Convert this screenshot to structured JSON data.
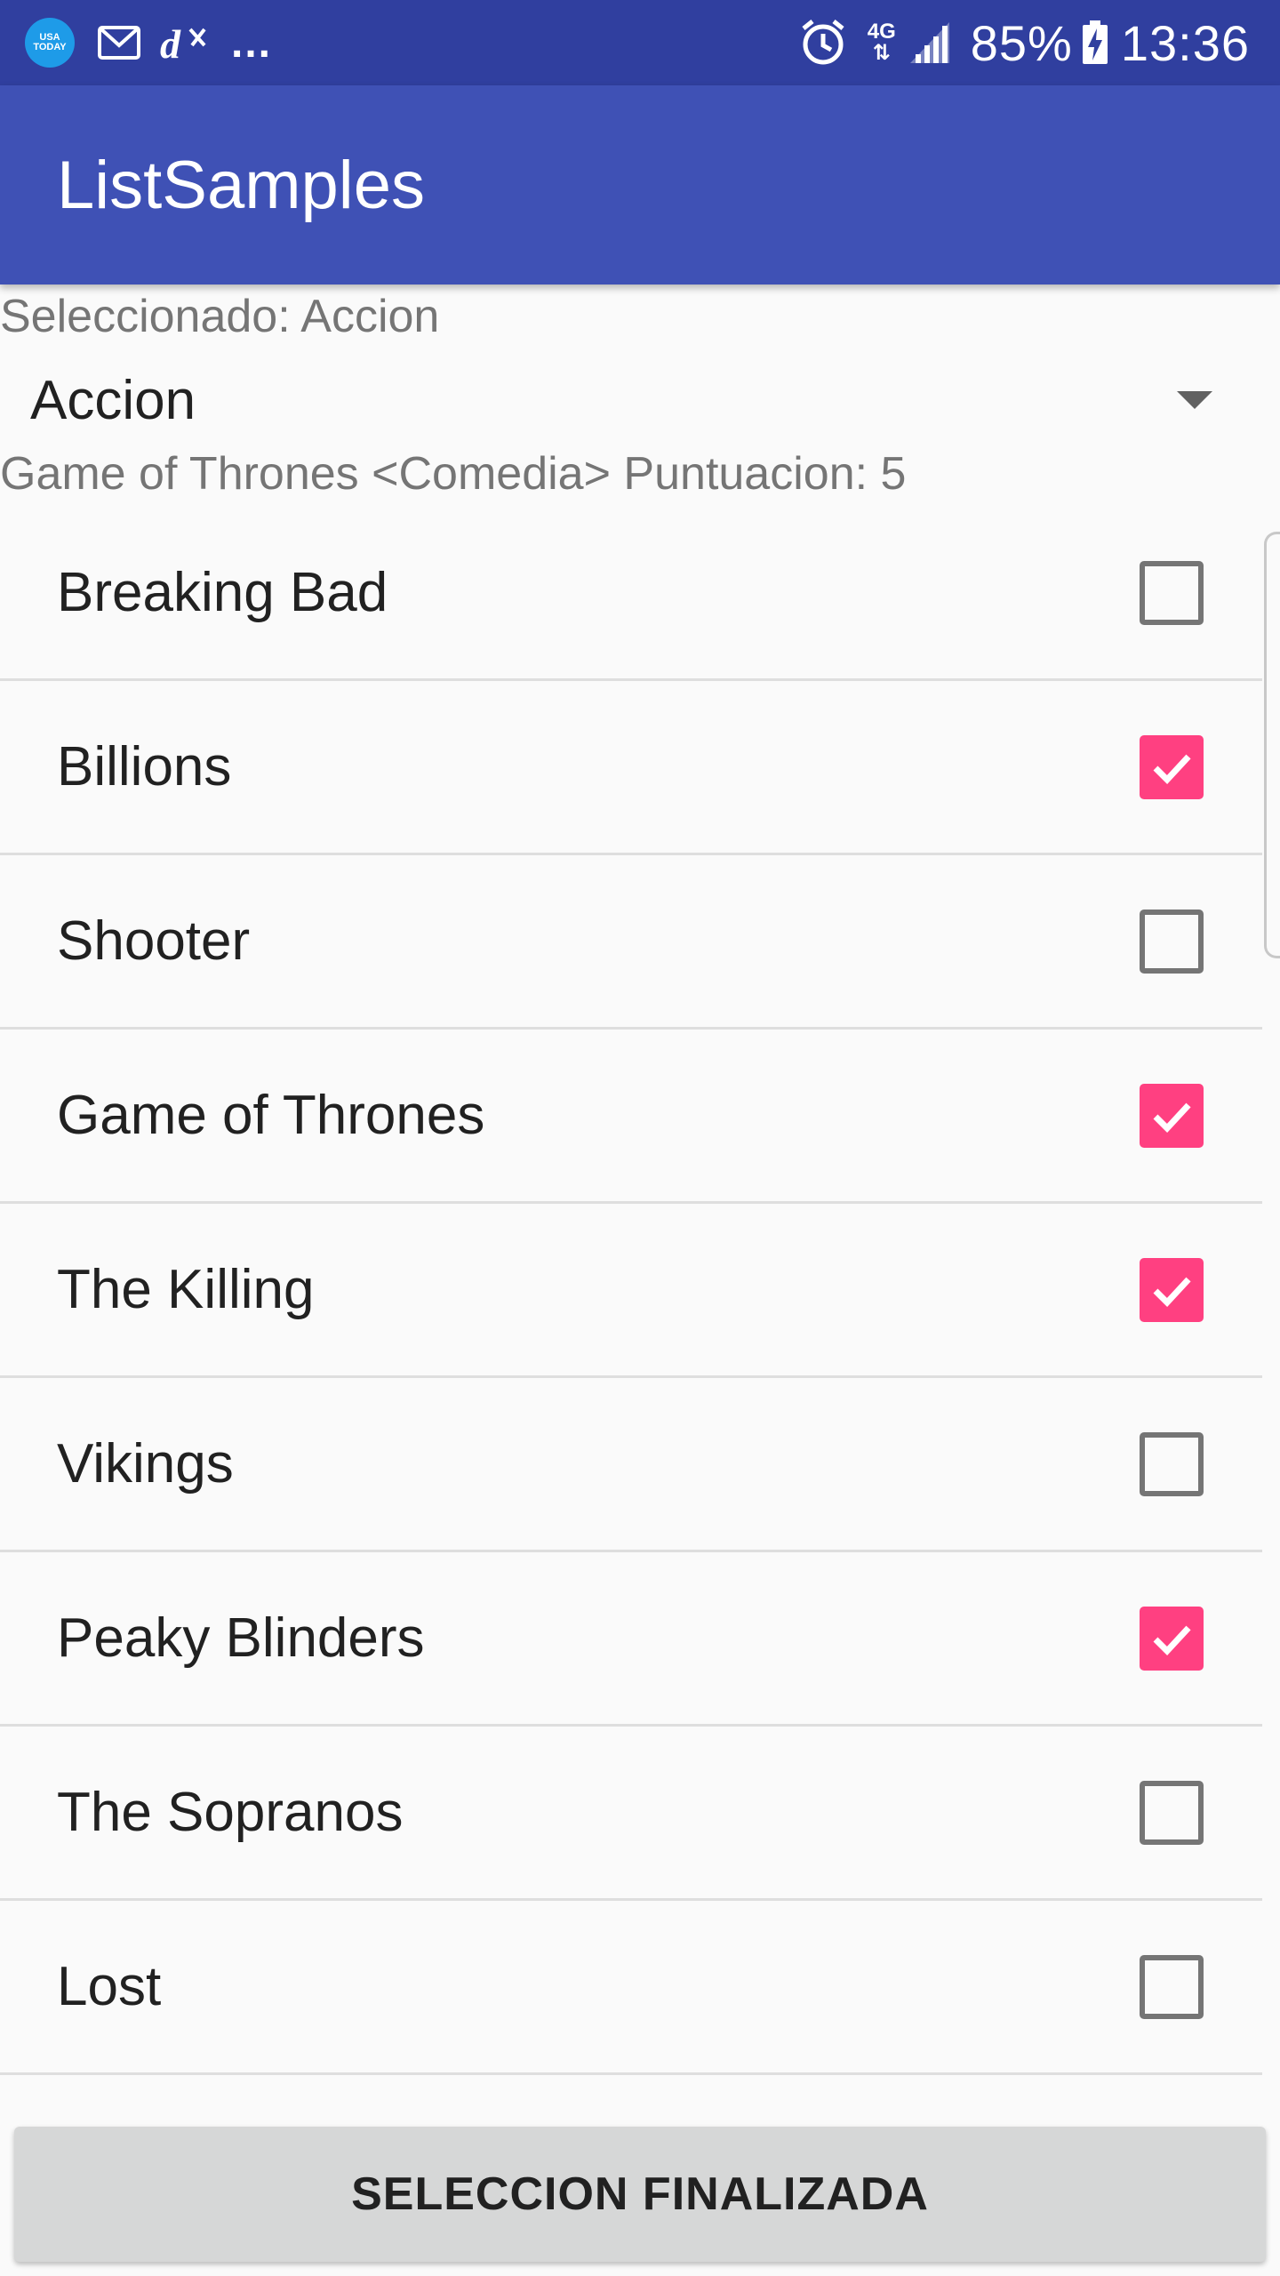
{
  "status_bar": {
    "notification_icons": [
      "usa-today-icon",
      "gmail-icon",
      "dazn-icon"
    ],
    "usa_today_line1": "USA",
    "usa_today_line2": "TODAY",
    "more": "...",
    "network_top": "4G",
    "battery": "85%",
    "time": "13:36"
  },
  "app_bar": {
    "title": "ListSamples"
  },
  "selected_label": "Seleccionado: Accion",
  "spinner": {
    "value": "Accion"
  },
  "detail_label": "Game of Thrones <Comedia> Puntuacion: 5",
  "list": {
    "items": [
      {
        "label": "Breaking Bad",
        "checked": false
      },
      {
        "label": "Billions",
        "checked": true
      },
      {
        "label": "Shooter",
        "checked": false
      },
      {
        "label": "Game of Thrones",
        "checked": true
      },
      {
        "label": "The Killing",
        "checked": true
      },
      {
        "label": "Vikings",
        "checked": false
      },
      {
        "label": "Peaky Blinders",
        "checked": true
      },
      {
        "label": "The Sopranos",
        "checked": false
      },
      {
        "label": "Lost",
        "checked": false
      }
    ]
  },
  "button": {
    "label": "SELECCION FINALIZADA"
  },
  "colors": {
    "status_bar": "#303f9f",
    "app_bar": "#3f51b5",
    "accent": "#ff4081"
  }
}
